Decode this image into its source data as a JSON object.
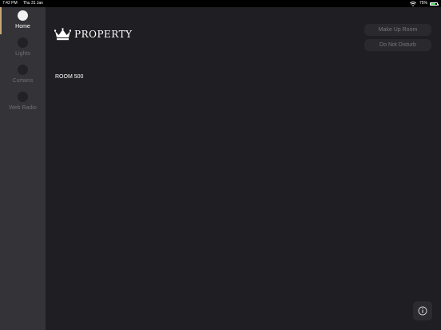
{
  "status_bar": {
    "time": "7:42 PM",
    "date": "Thu 31 Jan",
    "battery_text": "75%",
    "battery_level": 0.75,
    "battery_color": "#4cd964"
  },
  "sidebar": {
    "accent_color": "#c8a876",
    "items": [
      {
        "label": "Home",
        "active": true
      },
      {
        "label": "Lights",
        "active": false
      },
      {
        "label": "Curtains",
        "active": false
      },
      {
        "label": "Web Radio",
        "active": false
      }
    ]
  },
  "header": {
    "logo_icon": "crown-icon",
    "brand_name": "PROPERTY"
  },
  "main": {
    "room_label": "ROOM 500"
  },
  "actions": {
    "make_up_room_label": "Make Up Room",
    "do_not_disturb_label": "Do Not Disturb"
  },
  "footer": {
    "info_icon": "info-icon"
  }
}
